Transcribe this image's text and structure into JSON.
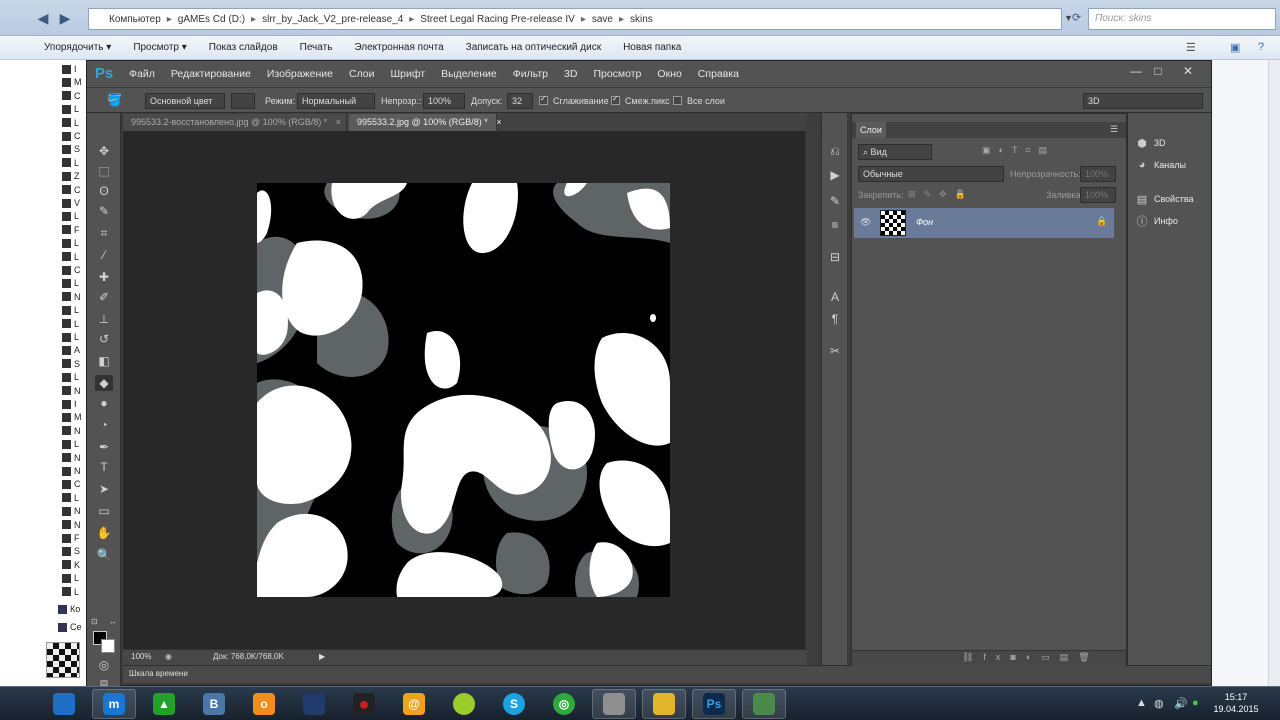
{
  "explorer": {
    "breadcrumb": [
      "Компьютер",
      "gAMEs Cd (D:)",
      "slrr_by_Jack_V2_pre-release_4",
      "Street Legal Racing Pre-release IV",
      "save",
      "skins"
    ],
    "search_placeholder": "Поиск: skins",
    "commands": [
      "Упорядочить ▾",
      "Просмотр ▾",
      "Показ слайдов",
      "Печать",
      "Электронная почта",
      "Записать на оптический диск",
      "Новая папка"
    ],
    "tree_labels": [
      "I",
      "M",
      "C",
      "L",
      "L",
      "C",
      "S",
      "L",
      "Z",
      "C",
      "V",
      "L",
      "F",
      "L",
      "L",
      "C",
      "L",
      "N",
      "L",
      "L",
      "L",
      "A",
      "S",
      "L",
      "N",
      "I",
      "M",
      "N",
      "L",
      "N",
      "N",
      "C",
      "L",
      "N",
      "N",
      "F",
      "S",
      "K",
      "L",
      "L"
    ],
    "bottom_items": [
      "Ко",
      "Се"
    ]
  },
  "photoshop": {
    "logo": "Ps",
    "menu": [
      "Файл",
      "Редактирование",
      "Изображение",
      "Слои",
      "Шрифт",
      "Выделение",
      "Фильтр",
      "3D",
      "Просмотр",
      "Окно",
      "Справка"
    ],
    "window_buttons": [
      "—",
      "□",
      "✕"
    ],
    "options": {
      "fill_source": "Основной цвет",
      "mode_label": "Режим:",
      "mode_value": "Нормальный",
      "opacity_label": "Непрозр.:",
      "opacity_value": "100%",
      "tolerance_label": "Допуск:",
      "tolerance_value": "32",
      "antialias_label": "Сглаживание",
      "antialias_checked": true,
      "contiguous_label": "Смеж.пикс",
      "contiguous_checked": true,
      "all_layers_label": "Все слои",
      "all_layers_checked": false,
      "workspace": "3D"
    },
    "tabs": [
      "995533.2-восстановлено.jpg @ 100% (RGB/8) *",
      "995533.2.jpg @ 100% (RGB/8) *"
    ],
    "active_tab": 1,
    "status": {
      "zoom": "100%",
      "doc": "Док: 768,0K/768,0K"
    },
    "timeline_label": "Шкала времени",
    "layers": {
      "tab": "Слои",
      "filter": "Вид",
      "blend": "Обычные",
      "opacity_label": "Непрозрачность:",
      "opacity_value": "100%",
      "lock_label": "Закрепить:",
      "fill_label": "Заливка:",
      "fill_value": "100%",
      "layer_name": "Фон"
    },
    "right_panel": [
      "3D",
      "Каналы",
      "Свойства",
      "Инфо"
    ]
  },
  "taskbar": {
    "time": "15:17",
    "date": "19.04.2015",
    "apps": [
      {
        "name": "windows-explorer",
        "label": "",
        "color": "#1e6fc5"
      },
      {
        "name": "maxthon",
        "label": "m",
        "color": "#1976d2"
      },
      {
        "name": "green-triangle",
        "label": "▲",
        "color": "#22a02a"
      },
      {
        "name": "vkontakte",
        "label": "В",
        "color": "#4a76a8"
      },
      {
        "name": "odnoklassniki",
        "label": "о",
        "color": "#f28c1a"
      },
      {
        "name": "monitor",
        "label": "",
        "color": "#1f3a6b"
      },
      {
        "name": "record",
        "label": "●",
        "color": "#d21d1d"
      },
      {
        "name": "mail-agent",
        "label": "@",
        "color": "#f0a21e"
      },
      {
        "name": "ball",
        "label": "",
        "color": "#9ccc2a"
      },
      {
        "name": "skype",
        "label": "S",
        "color": "#1aa3e0"
      },
      {
        "name": "radar",
        "label": "◎",
        "color": "#2faa3a"
      },
      {
        "name": "dashboard",
        "label": "",
        "color": "#8f8f8f"
      },
      {
        "name": "racing-game",
        "label": "",
        "color": "#e2b52a"
      },
      {
        "name": "photoshop",
        "label": "Ps",
        "color": "#0c2a4d"
      },
      {
        "name": "terminal",
        "label": "",
        "color": "#4a8a4a"
      }
    ]
  }
}
